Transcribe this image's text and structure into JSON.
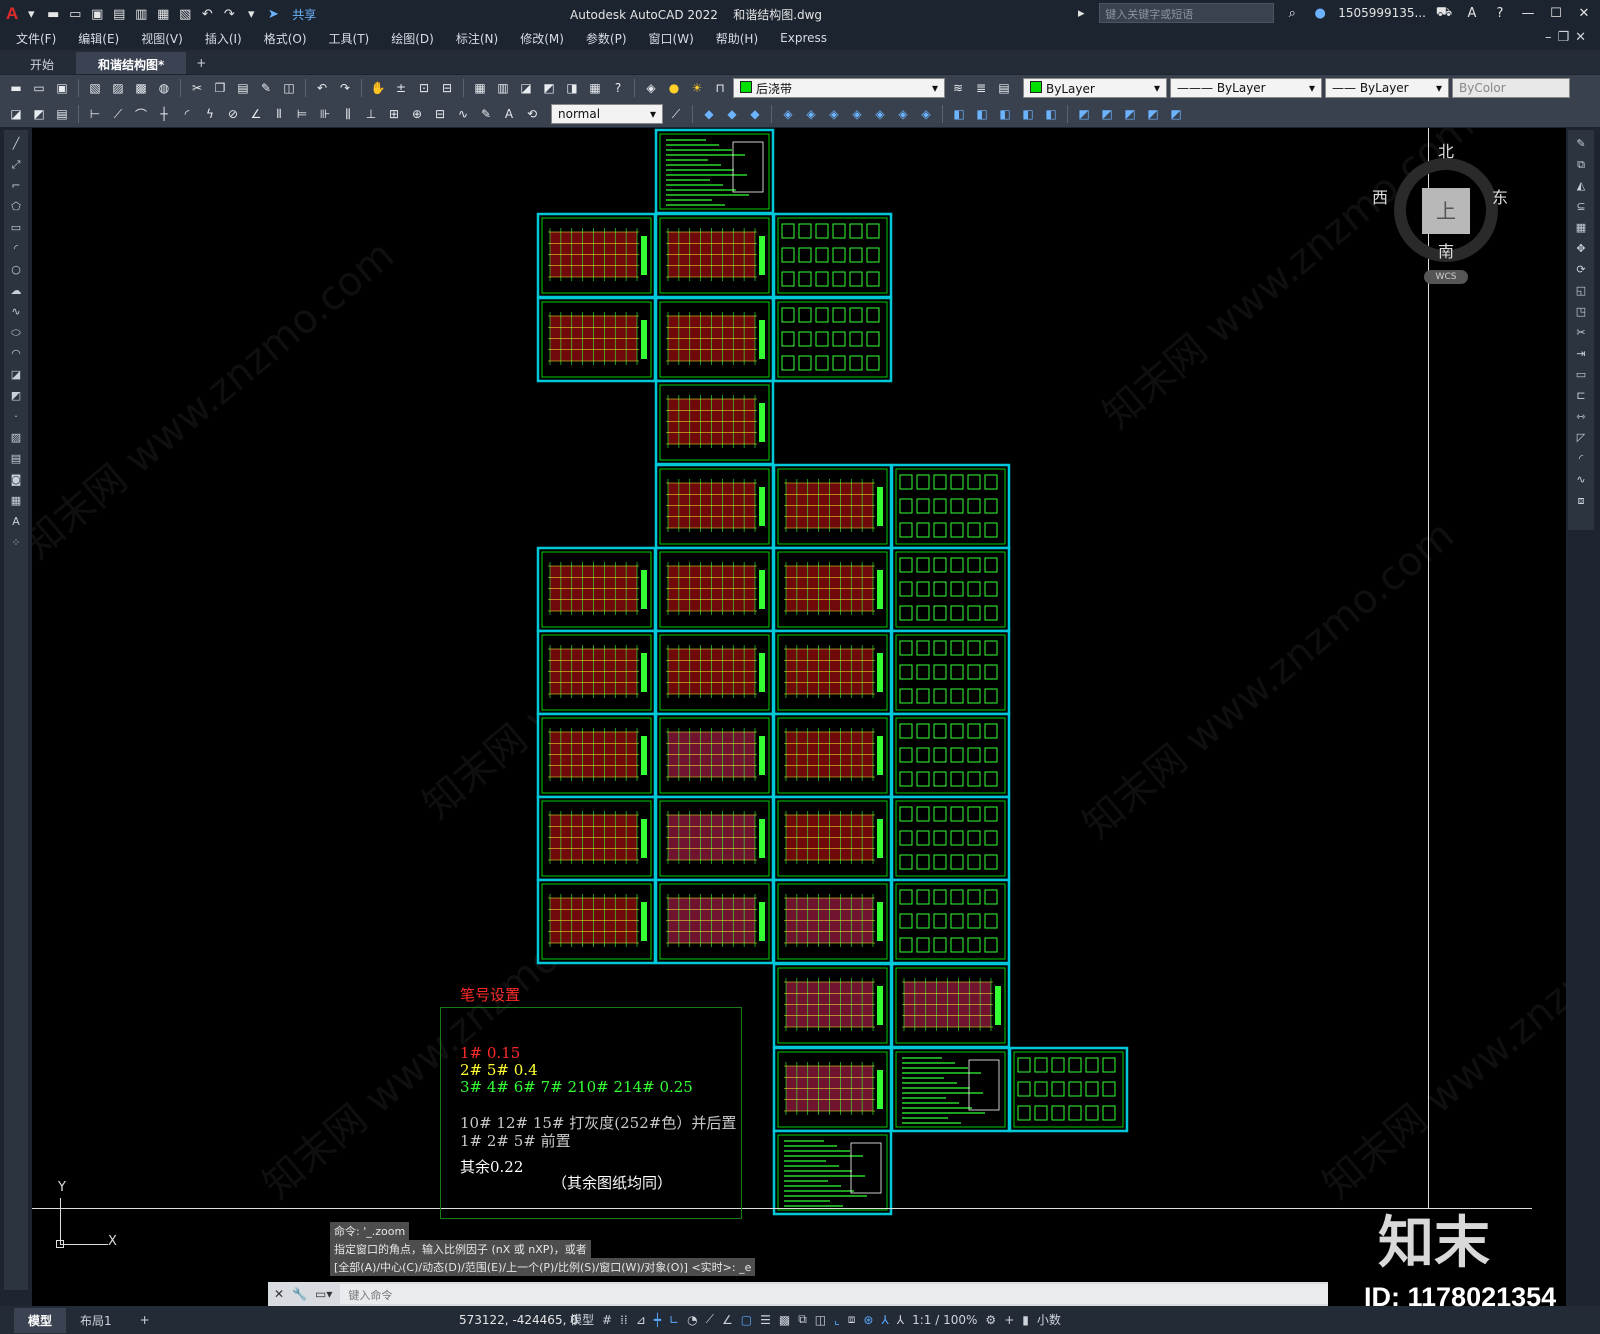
{
  "titlebar": {
    "share_label": "共享",
    "app_title": "Autodesk AutoCAD 2022",
    "file_name": "和谐结构图.dwg",
    "search_placeholder": "键入关键字或短语",
    "user": "1505999135..."
  },
  "menus": [
    "文件(F)",
    "编辑(E)",
    "视图(V)",
    "插入(I)",
    "格式(O)",
    "工具(T)",
    "绘图(D)",
    "标注(N)",
    "修改(M)",
    "参数(P)",
    "窗口(W)",
    "帮助(H)",
    "Express"
  ],
  "tabs": {
    "start": "开始",
    "doc": "和谐结构图*"
  },
  "properties": {
    "layer": "后浇带",
    "color": "ByLayer",
    "linetype": "ByLayer",
    "lineweight": "ByLayer",
    "plotstyle": "ByColor",
    "dimstyle": "normal"
  },
  "viewcube": {
    "north": "北",
    "south": "南",
    "west": "西",
    "east": "东",
    "top": "上",
    "wcs": "WCS"
  },
  "notes": {
    "title": "笔号设置",
    "line1": "1# 0.15",
    "line2": "2# 5# 0.4",
    "line3": "3# 4# 6# 7# 210# 214# 0.25",
    "line4": "10# 12# 15#  打灰度(252#色）并后置",
    "line5": "1#  2# 5# 前置",
    "line6": "其余0.22",
    "line7": "（其余图纸均同）"
  },
  "colors": {
    "red": "#ff2a2a",
    "yellow": "#ffff33",
    "green": "#33ff33",
    "gray": "#c8c8c8",
    "white": "#ffffff",
    "cyan": "#00c8d8"
  },
  "command": {
    "hist1": "命令: '_.zoom",
    "hist2": "指定窗口的角点，输入比例因子 (nX 或 nXP)，或者",
    "hist3": "[全部(A)/中心(C)/动态(D)/范围(E)/上一个(P)/比例(S)/窗口(W)/对象(O)] <实时>: _e",
    "placeholder": "键入命令"
  },
  "ucs": {
    "x": "X",
    "y": "Y"
  },
  "status": {
    "model_tab": "模型",
    "layout_tab": "布局1",
    "add_tab": "+",
    "coords": "573122, -424465, 0",
    "model": "模型",
    "scale": "1:1 / 100%",
    "units": "小数"
  },
  "watermark": {
    "brand": "知末",
    "id": "ID: 1178021354",
    "text": "知末网 www.znzmo.com"
  }
}
